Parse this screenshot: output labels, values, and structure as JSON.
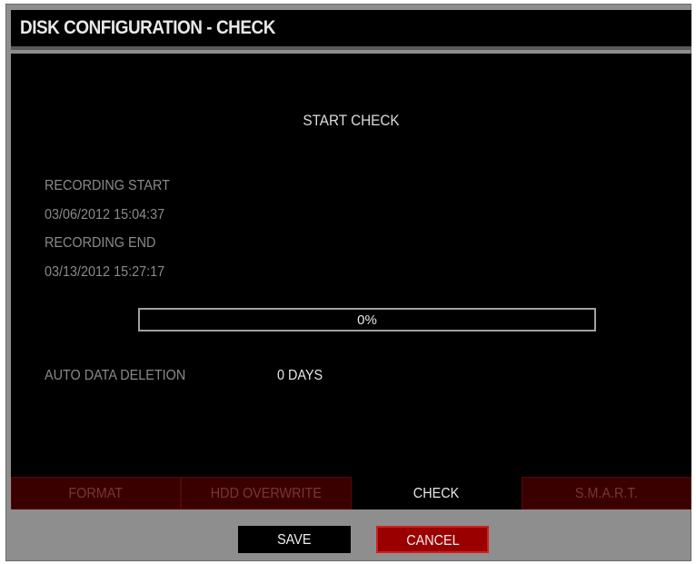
{
  "window": {
    "title": "DISK CONFIGURATION - CHECK"
  },
  "check_panel": {
    "heading": "START CHECK",
    "recording_start_label": "RECORDING START",
    "recording_start_value": "03/06/2012 15:04:37",
    "recording_end_label": "RECORDING END",
    "recording_end_value": "03/13/2012 15:27:17",
    "progress_text": "0%",
    "progress_fraction": 0,
    "auto_deletion_label": "AUTO DATA DELETION",
    "auto_deletion_value": "0 DAYS"
  },
  "tabs": [
    {
      "label": "FORMAT",
      "active": false
    },
    {
      "label": "HDD OVERWRITE",
      "active": false
    },
    {
      "label": "CHECK",
      "active": true
    },
    {
      "label": "S.M.A.R.T.",
      "active": false
    }
  ],
  "buttons": {
    "save_label": "SAVE",
    "cancel_label": "CANCEL"
  },
  "colors": {
    "background": "#000000",
    "frame": "#8e8e8e",
    "tab_inactive": "#3a0000",
    "cancel": "#9a0000"
  }
}
